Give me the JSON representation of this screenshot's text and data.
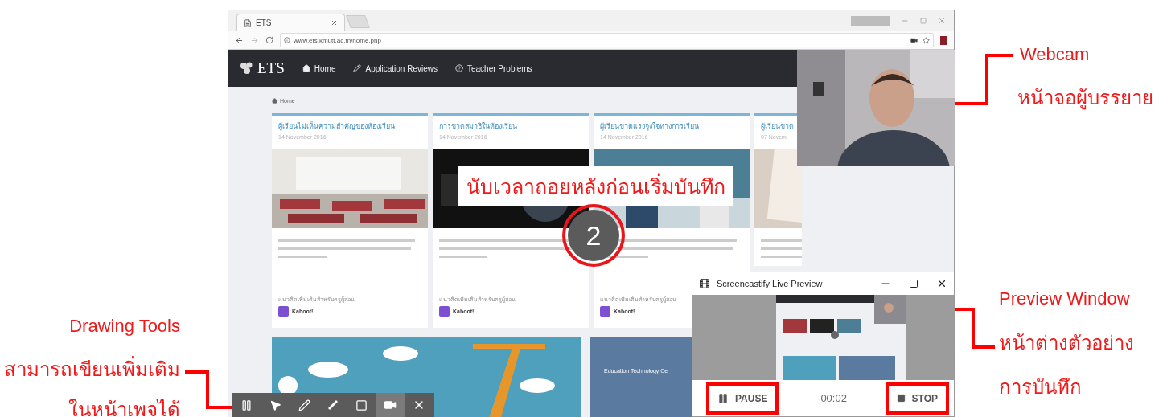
{
  "browser": {
    "tab_title": "ETS",
    "url": "www.ets.kmutt.ac.th/home.php"
  },
  "navbar": {
    "logo": "ETS",
    "items": [
      {
        "kind": "home",
        "label": "Home"
      },
      {
        "kind": "pencil",
        "label": "Application Reviews"
      },
      {
        "kind": "question",
        "label": "Teacher Problems"
      }
    ]
  },
  "breadcrumb": "Home",
  "cards": [
    {
      "title": "ผู้เรียนไม่เห็นความสำคัญของห้องเรียน",
      "date": "14 November 2016",
      "footer": "แนวคิดเพิ่มเติมสำหรับครูผู้สอน",
      "app": "Kahoot!",
      "kind": "classroom"
    },
    {
      "title": "การขาดสมาธิในห้องเรียน",
      "date": "14 November 2016",
      "footer": "แนวคิดเพิ่มเติมสำหรับครูผู้สอน",
      "app": "Kahoot!",
      "kind": "dark"
    },
    {
      "title": "ผู้เรียนขาดแรงจูงใจทางการเรียน",
      "date": "14 November 2016",
      "footer": "แนวคิดเพิ่มเติมสำหรับครูผู้สอน",
      "app": "Kahoot!",
      "kind": "people"
    },
    {
      "title": "ผู้เรียนขาด",
      "date": "07 Novem",
      "kind": "paper"
    }
  ],
  "banner": {
    "text": "Education Technology Ce"
  },
  "countdown": {
    "caption": "นับเวลาถอยหลังก่อนเริ่มบันทึก",
    "number": "2"
  },
  "preview_window": {
    "title": "Screencastify Live Preview",
    "pause": "PAUSE",
    "timer": "-00:02",
    "stop": "STOP"
  },
  "drawing_toolbar": [
    {
      "kind": "pause",
      "selected": false
    },
    {
      "kind": "pointer",
      "selected": false
    },
    {
      "kind": "pen",
      "selected": false
    },
    {
      "kind": "marker",
      "selected": false
    },
    {
      "kind": "rectangle",
      "selected": false
    },
    {
      "kind": "camera",
      "selected": true
    },
    {
      "kind": "close",
      "selected": false
    }
  ],
  "annotations": {
    "webcam": [
      "Webcam",
      "หน้าจอผู้บรรยาย"
    ],
    "preview": [
      "Preview Window",
      "หน้าต่างตัวอย่าง",
      "การบันทึก"
    ],
    "tools": [
      "Drawing Tools",
      "สามารถเขียนเพิ่มเติม",
      "ในหน้าเพจได้"
    ]
  }
}
